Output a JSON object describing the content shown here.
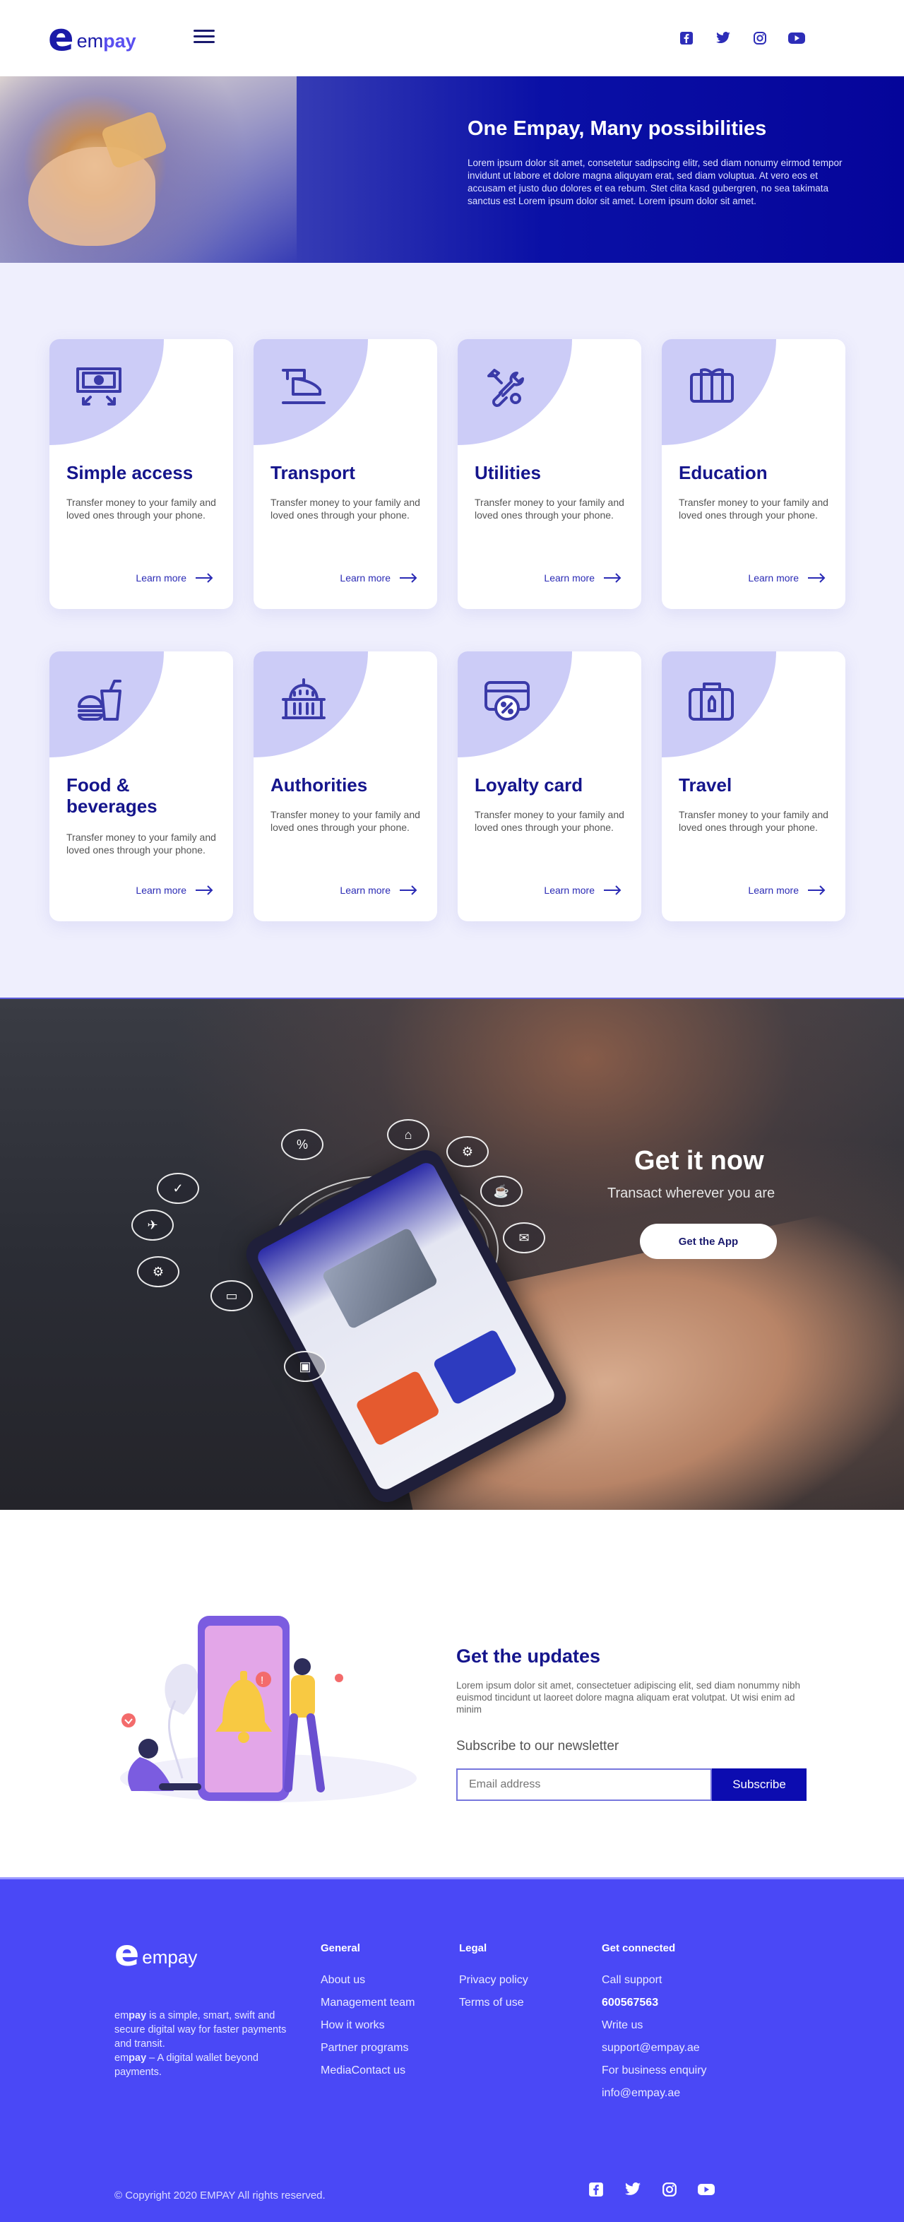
{
  "header": {
    "logo_letter": "e",
    "logo_em": "em",
    "logo_pay": "pay",
    "social": [
      "facebook-icon",
      "twitter-icon",
      "instagram-icon",
      "youtube-icon"
    ]
  },
  "hero": {
    "title": "One Empay, Many possibilities",
    "text": "Lorem ipsum dolor sit amet, consetetur sadipscing elitr, sed diam nonumy eirmod tempor invidunt ut labore et dolore magna aliquyam erat, sed diam voluptua. At vero eos et accusam et justo duo dolores et ea rebum. Stet clita kasd gubergren, no sea takimata sanctus est Lorem ipsum dolor sit amet. Lorem ipsum dolor sit amet."
  },
  "services": [
    {
      "title": "Simple access",
      "icon": "cash-exchange-icon",
      "text": "Transfer money to your family and loved ones through your phone.",
      "link": "Learn more"
    },
    {
      "title": "Transport",
      "icon": "train-icon",
      "text": "Transfer money to your family and loved ones through your phone.",
      "link": "Learn more"
    },
    {
      "title": "Utilities",
      "icon": "tools-icon",
      "text": "Transfer money to your family and loved ones through your phone.",
      "link": "Learn more"
    },
    {
      "title": "Education",
      "icon": "book-icon",
      "text": "Transfer money to your family and loved ones through your phone.",
      "link": "Learn more"
    },
    {
      "title": "Food & beverages",
      "icon": "fast-food-icon",
      "text": "Transfer money to your family and loved ones through your phone.",
      "link": "Learn more"
    },
    {
      "title": "Authorities",
      "icon": "government-building-icon",
      "text": "Transfer money to your family and loved ones through your phone.",
      "link": "Learn more"
    },
    {
      "title": "Loyalty card",
      "icon": "discount-card-icon",
      "text": "Transfer money to your family and loved ones through your phone.",
      "link": "Learn more"
    },
    {
      "title": "Travel",
      "icon": "luggage-icon",
      "text": "Transfer money to your family and loved ones through your phone.",
      "link": "Learn more"
    }
  ],
  "promo": {
    "title": "Get it now",
    "subtitle": "Transact wherever you are",
    "button": "Get the App"
  },
  "updates": {
    "title": "Get the updates",
    "text": "Lorem ipsum dolor sit amet, consectetuer adipiscing elit, sed diam nonummy nibh euismod tincidunt ut laoreet dolore magna aliquam erat volutpat. Ut wisi enim ad minim",
    "subscribe_label": "Subscribe to our newsletter",
    "email_placeholder": "Email address",
    "button": "Subscribe"
  },
  "footer": {
    "about_em": "em",
    "about_pay": "pay",
    "about_1": " is a simple, smart, swift and secure digital way for faster payments and transit.",
    "about_2": " – A digital wallet beyond payments.",
    "general": {
      "heading": "General",
      "links": [
        "About us",
        "Management team",
        "How it works",
        "Partner programs",
        "MediaContact us"
      ]
    },
    "legal": {
      "heading": "Legal",
      "links": [
        "Privacy policy",
        "Terms of use"
      ]
    },
    "connect": {
      "heading": "Get connected",
      "links": [
        "Call support",
        "600567563",
        "Write us",
        "support@empay.ae",
        "For business enquiry",
        "info@empay.ae"
      ]
    },
    "copyright": "© Copyright 2020 EMPAY All rights reserved."
  },
  "colors": {
    "brand": "#15158c",
    "accent": "#4a48f6",
    "button": "#0c0cb0"
  }
}
